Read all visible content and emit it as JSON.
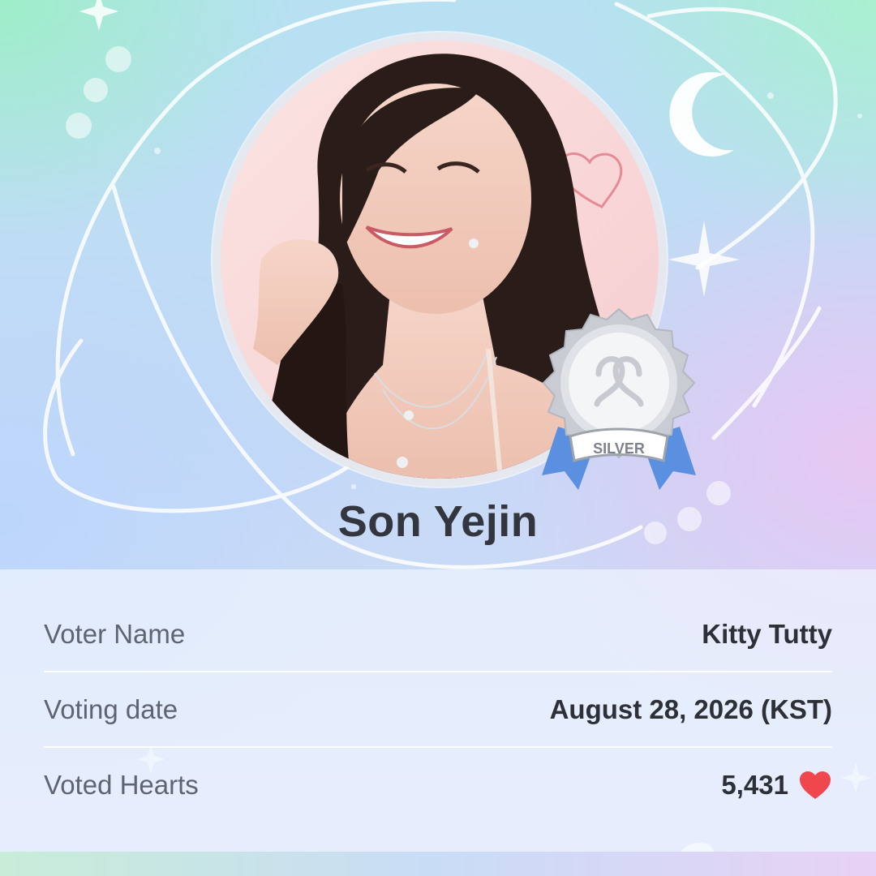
{
  "artist": {
    "name": "Son Yejin"
  },
  "badge": {
    "tier_label": "SILVER",
    "ribbon_color": "#5b8fe0",
    "medal_color": "#c9ccd3"
  },
  "vote_info": {
    "rows": [
      {
        "label": "Voter Name",
        "value": "Kitty Tutty"
      },
      {
        "label": "Voting date",
        "value": "August 28, 2026 (KST)"
      },
      {
        "label": "Voted Hearts",
        "value": "5,431",
        "icon": "heart-icon"
      }
    ]
  },
  "colors": {
    "heart": "#f0474f",
    "name_text": "#33363f",
    "label_text": "#5f6470"
  }
}
